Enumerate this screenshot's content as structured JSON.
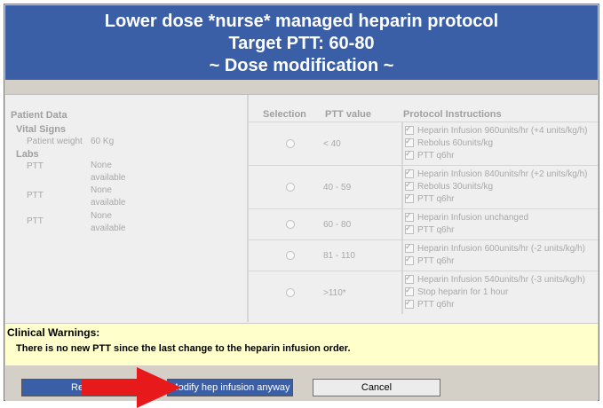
{
  "header": {
    "line1": "Lower dose *nurse* managed heparin protocol",
    "line2": "Target PTT: 60-80",
    "line3": "~ Dose modification ~"
  },
  "patient": {
    "title": "Patient Data",
    "vital_signs": "Vital Signs",
    "weight_label": "Patient weight",
    "weight_value": "60 Kg",
    "labs_title": "Labs",
    "labs": [
      {
        "name": "PTT",
        "value": "None available"
      },
      {
        "name": "PTT",
        "value": "None available"
      },
      {
        "name": "PTT",
        "value": "None available"
      }
    ]
  },
  "table": {
    "col_selection": "Selection",
    "col_ptt": "PTT value",
    "col_instructions": "Protocol Instructions",
    "rows": [
      {
        "ptt": "< 40",
        "instructions": [
          "Heparin Infusion 960units/hr (+4 units/kg/h)",
          "Rebolus 60units/kg",
          "PTT q6hr"
        ]
      },
      {
        "ptt": "40 - 59",
        "instructions": [
          "Heparin Infusion 840units/hr (+2 units/kg/h)",
          "Rebolus 30units/kg",
          "PTT q6hr"
        ]
      },
      {
        "ptt": "60 - 80",
        "instructions": [
          "Heparin Infusion unchanged",
          "PTT q6hr"
        ]
      },
      {
        "ptt": "81 - 110",
        "instructions": [
          "Heparin Infusion 600units/hr (-2 units/kg/h)",
          "PTT q6hr"
        ]
      },
      {
        "ptt": ">110*",
        "instructions": [
          "Heparin Infusion 540units/hr (-3 units/kg/h)",
          "Stop heparin for 1 hour",
          "PTT q6hr"
        ]
      }
    ]
  },
  "warnings": {
    "title": "Clinical Warnings:",
    "text": "There is no new PTT since the last change to the heparin infusion order."
  },
  "buttons": {
    "redraw": "Redraw",
    "modify": "Modify hep infusion anyway",
    "cancel": "Cancel"
  },
  "colors": {
    "header_bg": "#3a5fa6",
    "warning_bg": "#ffffcc",
    "arrow": "#e8191b"
  }
}
